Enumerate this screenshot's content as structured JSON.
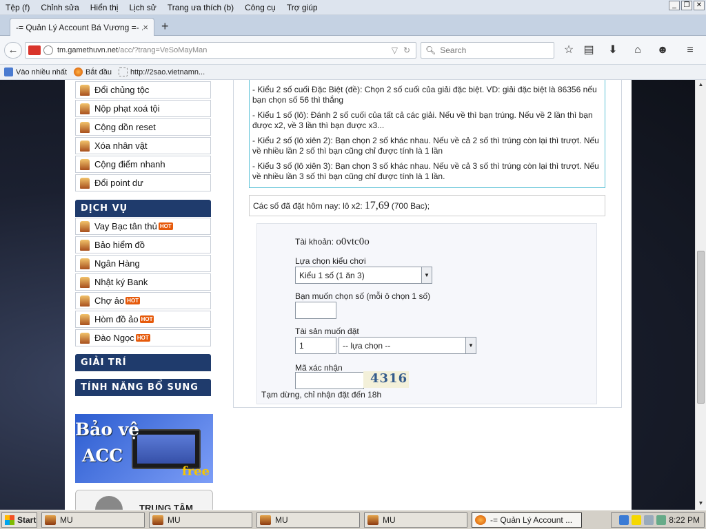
{
  "menubar": {
    "items": [
      {
        "label": "Tệp (f)"
      },
      {
        "label": "Chỉnh sửa"
      },
      {
        "label": "Hiển thị"
      },
      {
        "label": "Lịch sử"
      },
      {
        "label": "Trang ưa thích (b)"
      },
      {
        "label": "Công cụ"
      },
      {
        "label": "Trợ giúp"
      }
    ]
  },
  "tab": {
    "title": "-= Quản Lý Account Bá Vương =- ...",
    "close": "×",
    "new_tab": "+"
  },
  "address": {
    "url_host": "tm.gamethuvn.net",
    "url_path": "/acc/?trang=VeSoMayMan"
  },
  "search": {
    "placeholder": "Search"
  },
  "bookmarks": [
    {
      "label": "Vào nhiều nhất"
    },
    {
      "label": "Bắt đầu"
    },
    {
      "label": "http://2sao.vietnamn..."
    }
  ],
  "sidebar": {
    "top_items": [
      {
        "label": "Đổi chủng tộc"
      },
      {
        "label": "Nộp phạt xoá tội"
      },
      {
        "label": "Cộng dồn reset"
      },
      {
        "label": "Xóa nhân vật"
      },
      {
        "label": "Cộng điểm nhanh"
      },
      {
        "label": "Đổi point dư"
      }
    ],
    "dich_vu_header": "DỊCH VỤ",
    "service_items": [
      {
        "label": "Vay Bạc tân thủ",
        "badge": "HOT"
      },
      {
        "label": "Bảo hiểm đồ",
        "badge": ""
      },
      {
        "label": "Ngân Hàng",
        "badge": ""
      },
      {
        "label": "Nhật ký Bank",
        "badge": ""
      },
      {
        "label": "Chợ ảo",
        "badge": "HOT"
      },
      {
        "label": "Hòm đồ ảo",
        "badge": "HOT"
      },
      {
        "label": "Đào Ngọc",
        "badge": "HOT"
      }
    ],
    "giai_tri_header": "GIẢI TRÍ",
    "tinh_nang_header": "TÍNH NĂNG BỔ SUNG",
    "banner": {
      "line1": "Bảo vệ",
      "line2": "ACC",
      "line3": "free"
    },
    "banner2": {
      "text": "TRUNG TÂM"
    }
  },
  "rules": [
    "- Kiểu 2 số cuối Đặc Biệt (đề): Chọn 2 số cuối của giải đặc biệt. VD: giải đặc biệt là 86356 nếu bạn chọn số 56 thì thắng",
    "- Kiểu 1 số (lô): Đánh 2 số cuối của tất cả các giải. Nếu về thì bạn trúng. Nếu về 2 lần thì bạn được x2, về 3 lần thì bạn được x3...",
    "- Kiểu 2 số (lô xiên 2): Bạn chọn 2 số khác nhau. Nếu về cả 2 số thì trúng còn lại thì trượt. Nếu về nhiều lần 2 số thì bạn cũng chỉ được tính là 1 lần",
    "- Kiểu 3 số (lô xiên 3): Bạn chọn 3 số khác nhau. Nếu về cả 3 số thì trúng còn lại thì trượt. Nếu về nhiều lần 3 số thì bạn cũng chỉ được tính là 1 lần."
  ],
  "today": {
    "prefix": "Các số đã đặt hôm nay: lô x2:",
    "numbers": "17,69",
    "suffix": "(700 Bac);"
  },
  "form": {
    "account_label": "Tài khoản:",
    "account_value": "o0vtc0o",
    "play_type_label": "Lựa chọn kiểu chơi",
    "play_type_value": "Kiểu 1 số (1 ăn 3)",
    "number_label": "Bạn muốn chọn số (mỗi ô chọn 1 số)",
    "number_value": "",
    "asset_label": "Tài sản muốn đặt",
    "asset_amount": "1",
    "asset_type_value": "-- lựa chọn --",
    "captcha_label": "Mã xác nhận",
    "captcha_value": "",
    "captcha_image_text": "4316",
    "notice": "Tạm dừng, chỉ nhận đặt đến 18h"
  },
  "taskbar": {
    "start": "Start",
    "tasks": [
      {
        "label": "MU"
      },
      {
        "label": "MU"
      },
      {
        "label": "MU"
      },
      {
        "label": "MU"
      },
      {
        "label": "-= Quản Lý Account ..."
      }
    ],
    "clock": "8:22 PM"
  }
}
